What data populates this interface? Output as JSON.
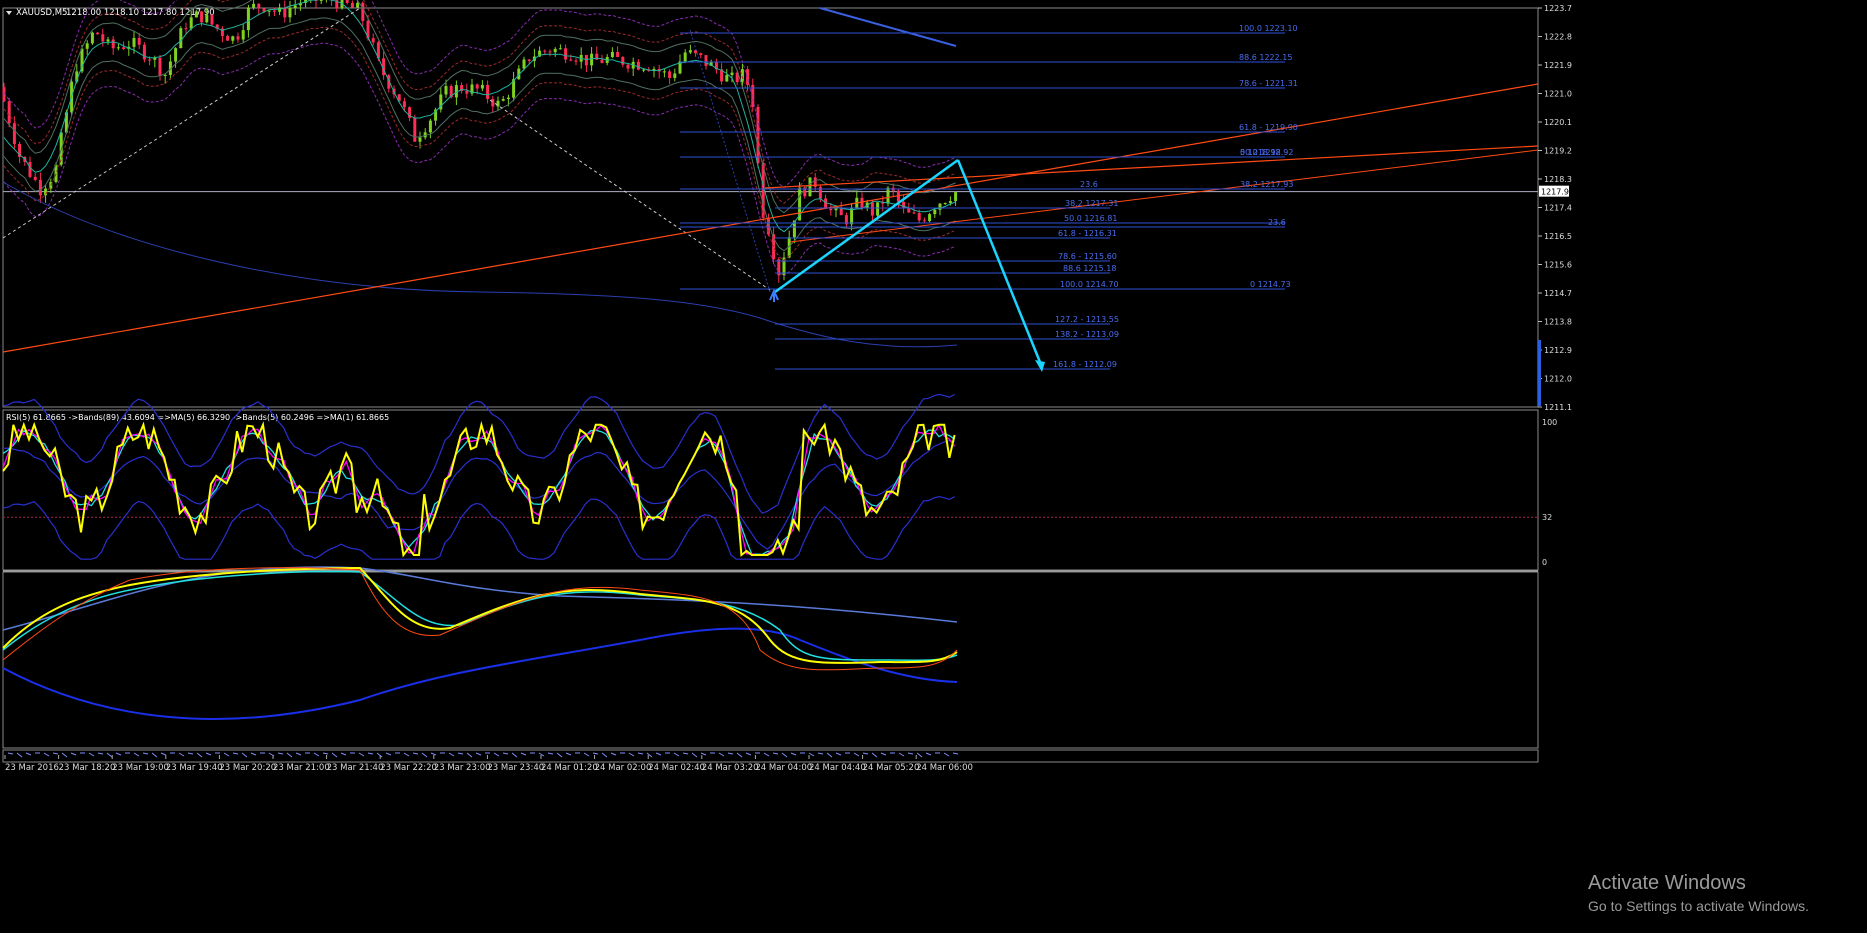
{
  "chart_header": {
    "symbol": "XAUUSD,M5",
    "ohlc": "1218.00 1218.10 1217.80 1217.90"
  },
  "chart_data": {
    "type": "candlestick",
    "price_axis": {
      "ticks": [
        "1223.7",
        "1222.8",
        "1221.9",
        "1221.0",
        "1220.1",
        "1219.2",
        "1218.3",
        "1217.4",
        "1216.5",
        "1215.6",
        "1214.7",
        "1213.8",
        "1212.9",
        "1212.0",
        "1211.1"
      ],
      "current_price_label": "1217.9"
    },
    "time_axis": {
      "labels": [
        "23 Mar 2016",
        "23 Mar 18:20",
        "23 Mar 19:00",
        "23 Mar 19:40",
        "23 Mar 20:20",
        "23 Mar 21:00",
        "23 Mar 21:40",
        "23 Mar 22:20",
        "23 Mar 23:00",
        "23 Mar 23:40",
        "24 Mar 01:20",
        "24 Mar 02:00",
        "24 Mar 02:40",
        "24 Mar 03:20",
        "24 Mar 04:00",
        "24 Mar 04:40",
        "24 Mar 05:20",
        "24 Mar 06:00"
      ]
    },
    "fibonacci_levels": [
      {
        "label": "100.0  1223.10",
        "price": 1223.1
      },
      {
        "label": "88.6  1222.15",
        "price": 1222.15
      },
      {
        "label": "78.6 - 1221.31",
        "price": 1221.31
      },
      {
        "label": "61.8 - 1219.90",
        "price": 1219.9
      },
      {
        "label": "0  1218.92",
        "price": 1218.92
      },
      {
        "label": "50.0  1218.92",
        "price": 1218.92
      },
      {
        "label": "23.6",
        "price": 1217.9
      },
      {
        "label": "38.2  1217.93",
        "price": 1217.93
      },
      {
        "label": "38.2  1217.31",
        "price": 1217.31
      },
      {
        "label": "50.0  1216.81",
        "price": 1216.81
      },
      {
        "label": "23.6",
        "price": 1216.81
      },
      {
        "label": "61.8 - 1216.31",
        "price": 1216.31
      },
      {
        "label": "78.6 - 1215.60",
        "price": 1215.6
      },
      {
        "label": "88.6  1215.18",
        "price": 1215.18
      },
      {
        "label": "100.0  1214.70",
        "price": 1214.7
      },
      {
        "label": "0  1214.73",
        "price": 1214.73
      },
      {
        "label": "127.2 - 1213.55",
        "price": 1213.55
      },
      {
        "label": "138.2 - 1213.09",
        "price": 1213.09
      },
      {
        "label": "161.8 -  1212.09",
        "price": 1212.09
      }
    ],
    "rsi_panel": {
      "header": "RSI(5) 61.8665  ->Bands(89) 43.6094  =>MA(5) 66.3290  ->Bands(5) 60.2496  =>MA(1) 61.8665",
      "scale_labels": [
        "100",
        "32",
        "0"
      ]
    },
    "colors": {
      "bull_candle": "#7fd320",
      "bear_candle": "#ff2d55",
      "fib_line": "#2e4fd6",
      "trend_line": "#ff4a14",
      "arrow": "#1ad5ff",
      "rsi": "#ffff00",
      "rsi_ma": "#ff00ff",
      "rsi_ma2": "#20e0e0"
    }
  },
  "watermark": {
    "title": "Activate Windows",
    "subtitle": "Go to Settings to activate Windows."
  }
}
